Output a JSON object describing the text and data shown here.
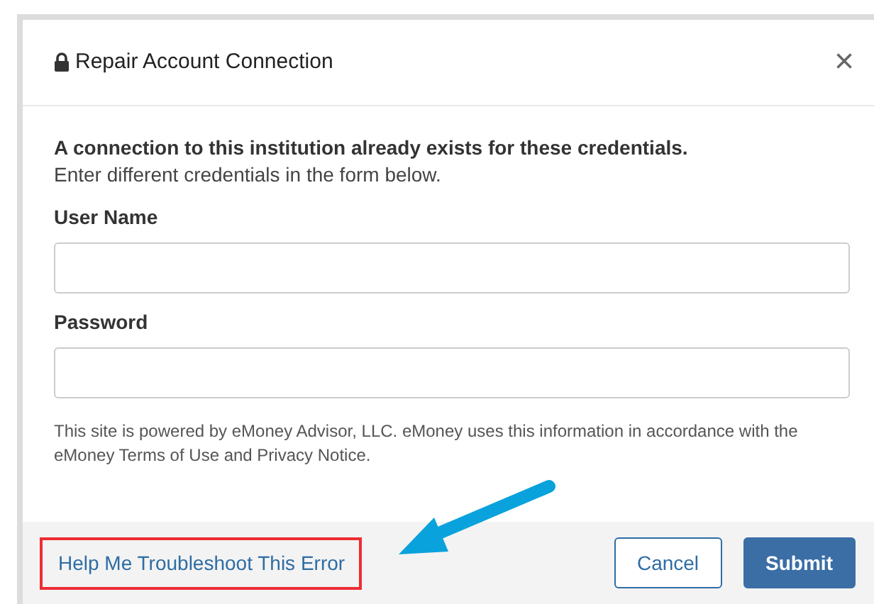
{
  "dialog": {
    "title": "Repair Account Connection",
    "close": "×"
  },
  "message": {
    "heading": "A connection to this institution already exists for these credentials.",
    "text": "Enter different credentials in the form below."
  },
  "fields": [
    {
      "label": "User Name"
    },
    {
      "label": "Password"
    }
  ],
  "disclaimer": "This site is powered by eMoney Advisor, LLC. eMoney uses this information in accordance with the eMoney Terms of Use and Privacy Notice.",
  "footer": {
    "help_link": "Help Me Troubleshoot This Error",
    "buttons": [
      {
        "label": "Cancel",
        "kind": "secondary"
      },
      {
        "label": "Submit",
        "kind": "primary"
      }
    ]
  }
}
